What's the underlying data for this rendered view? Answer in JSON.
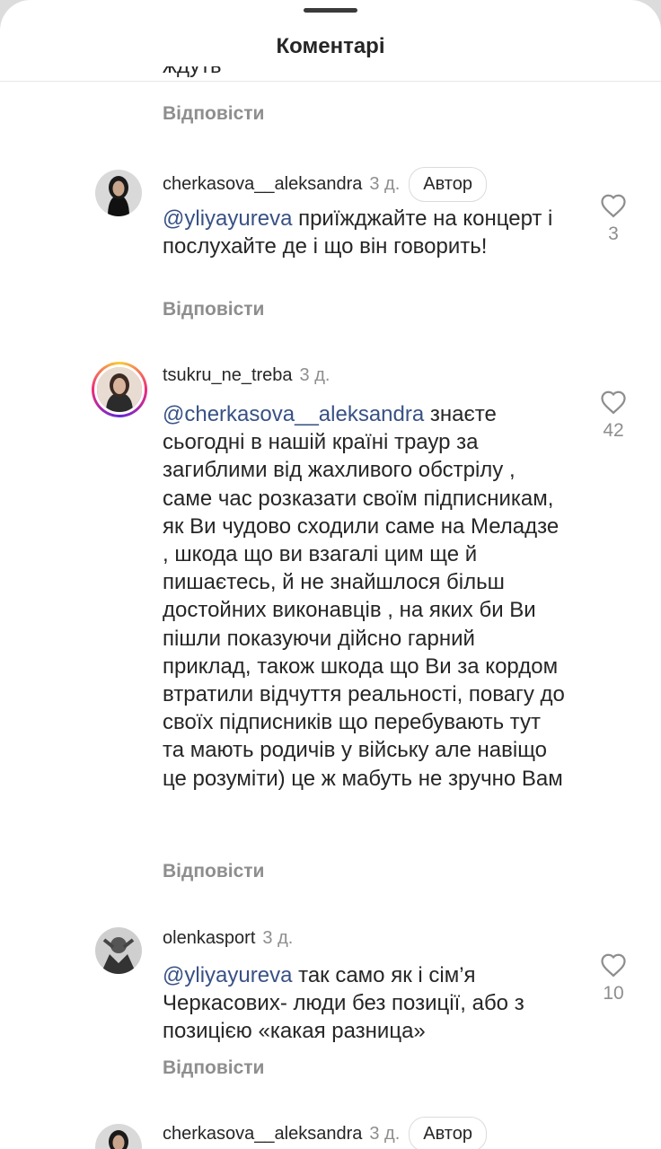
{
  "header": {
    "title": "Коментарі"
  },
  "partial_comment_text": "ждуть",
  "reply_label": "Відповісти",
  "author_badge": "Автор",
  "comments": [
    {
      "username": "cherkasova__aleksandra",
      "time": "3 д.",
      "mention": "@yliyayureva",
      "text": " приїжджайте на концерт і послухайте де і що він говорить!",
      "likes": "3",
      "is_author": true,
      "avatar_icon": "person-avatar-icon"
    },
    {
      "username": "tsukru_ne_treba",
      "time": "3 д.",
      "mention": "@cherkasova__aleksandra",
      "text": " знаєте сьогодні в нашій країні траур за загиблими від жахливого обстрілу , саме час розказати своїм підписникам, як Ви чудово сходили саме на Меладзе , шкода що ви взагалі цим ще й пишаєтесь, й не знайшлося більш достойних виконавців , на яких би Ви пішли показуючи дійсно гарний приклад, також шкода що Ви за кордом втратили відчуття реальності, повагу до своїх підписників  що перебувають тут та мають родичів у війську але навіщо це розуміти) це ж мабуть не зручно Вам",
      "likes": "42",
      "has_story": true,
      "avatar_icon": "person-avatar-icon"
    },
    {
      "username": "olenkasport",
      "time": "3 д.",
      "mention": "@yliyayureva",
      "text": " так само як і сім’я Черкасових- люди без позиції, або з позицією «какая разница»",
      "likes": "10",
      "avatar_icon": "person-avatar-icon"
    },
    {
      "username": "cherkasova__aleksandra",
      "time": "3 д.",
      "is_author": true,
      "avatar_icon": "person-avatar-icon"
    }
  ],
  "colors": {
    "mention": "#385185",
    "secondary_text": "#8e8e8e",
    "primary_text": "#262626"
  }
}
